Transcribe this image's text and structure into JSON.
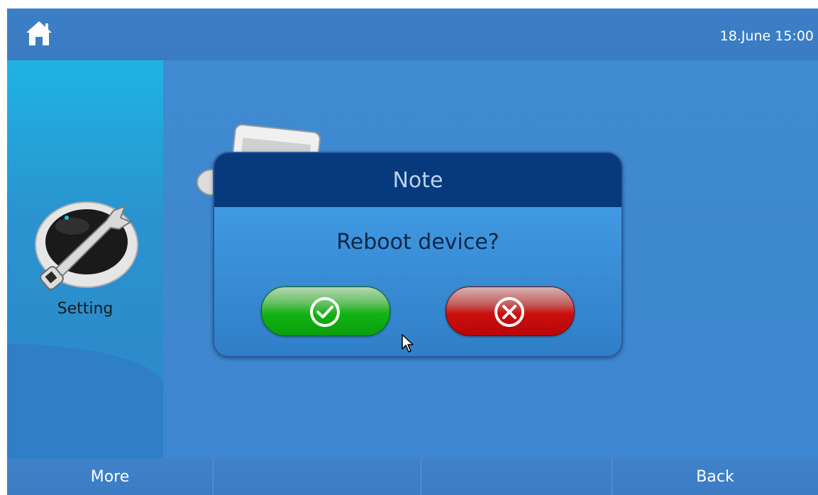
{
  "topbar": {
    "home_icon": "home-icon",
    "datetime": "18.June 15:00"
  },
  "sidebar": {
    "setting_label": "Setting",
    "setting_icon": "wrench-settings-icon"
  },
  "dialog": {
    "title": "Note",
    "message": "Reboot device?",
    "confirm_icon": "check-circle-icon",
    "cancel_icon": "x-circle-icon"
  },
  "bottombar": {
    "more_label": "More",
    "back_label": "Back"
  },
  "colors": {
    "screen_blue": "#3d86d0",
    "dialog_header": "#063a7c",
    "confirm_green": "#12b313",
    "cancel_red": "#cc0e0e"
  }
}
